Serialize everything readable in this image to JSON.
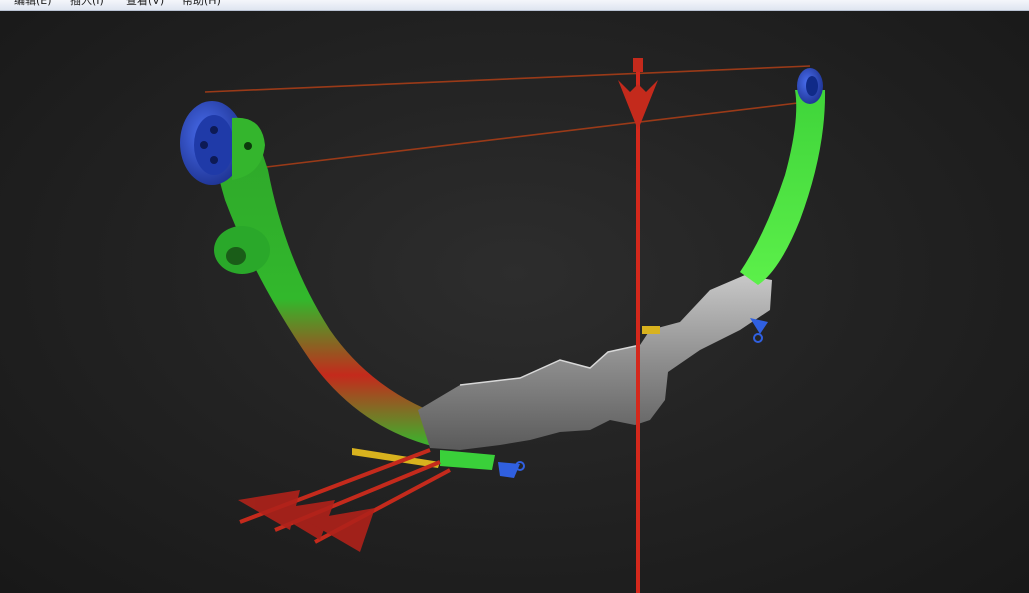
{
  "menubar": {
    "items": [
      {
        "label": "编辑(E)"
      },
      {
        "label": "插入(I)"
      },
      {
        "label": "查看(V)"
      },
      {
        "label": "帮助(H)"
      }
    ]
  },
  "colors": {
    "background": "#1e1e1e",
    "limb_green": "#35c22e",
    "stress_red": "#c42a1c",
    "cam_blue": "#2a4fc8",
    "riser_gray": "#8a8a8a",
    "arrow_rest_yellow": "#d8b21e",
    "string": "#8a3a1a"
  }
}
